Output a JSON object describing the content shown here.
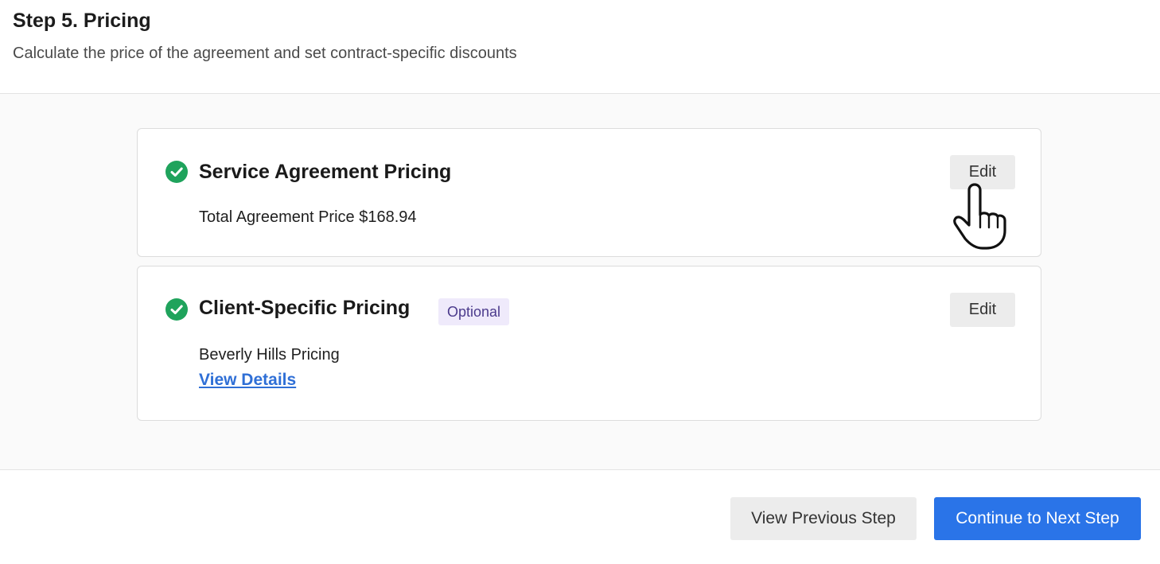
{
  "header": {
    "title": "Step 5. Pricing",
    "subtitle": "Calculate the price of the agreement and set contract-specific discounts"
  },
  "cards": [
    {
      "title": "Service Agreement Pricing",
      "detail": "Total Agreement Price $168.94",
      "edit_label": "Edit",
      "icon": "check-circle-icon"
    },
    {
      "title": "Client-Specific Pricing",
      "badge": "Optional",
      "detail": "Beverly Hills Pricing",
      "link": "View Details",
      "edit_label": "Edit",
      "icon": "check-circle-icon"
    }
  ],
  "footer": {
    "prev_label": "View Previous Step",
    "next_label": "Continue to Next Step"
  },
  "colors": {
    "accent": "#2a74e8",
    "success": "#1fa35c",
    "badge_bg": "#efeafb",
    "badge_text": "#4b3a8c"
  }
}
